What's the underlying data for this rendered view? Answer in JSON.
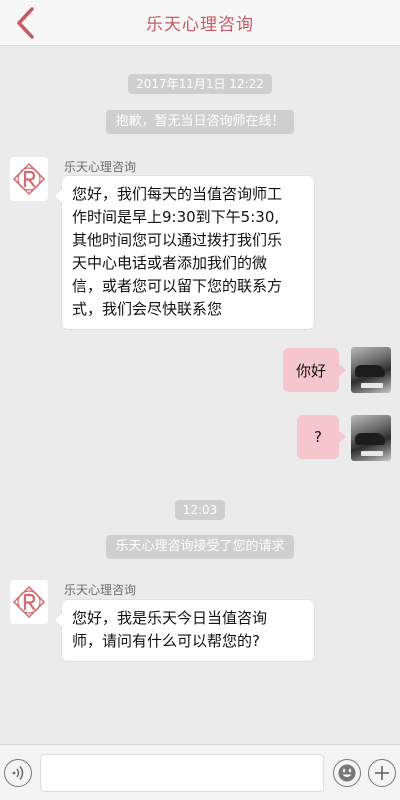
{
  "header": {
    "title": "乐天心理咨询",
    "back_icon": "chevron-left-icon"
  },
  "messages": {
    "timestamp_1": "2017年11月1日 12:22",
    "notice_1": "抱歉，暂无当日咨询师在线！",
    "sender_1": "乐天心理咨询",
    "msg_1_lines": [
      "您好，我们每天的当值咨询师工",
      "作时间是早上9:30到下午5:30,",
      "其他时间您可以通过拨打我们乐",
      "天中心电话或者添加我们的微",
      "信，或者您可以留下您的联系方",
      "式，我们会尽快联系您"
    ],
    "user_msg_1": "你好",
    "user_msg_2": "?",
    "timestamp_2": "12:03",
    "notice_2": "乐天心理咨询接受了您的请求",
    "sender_2": "乐天心理咨询",
    "msg_2_lines": [
      "您好，我是乐天今日当值咨询",
      "师，请问有什么可以帮您的?"
    ]
  },
  "colors": {
    "brand": "#c85a66",
    "user_bubble": "#f5c7cd",
    "system_pill": "#cfcfcf",
    "background": "#ebebeb"
  },
  "input_bar": {
    "text_value": "",
    "voice_icon": "voice-icon",
    "emoji_icon": "emoji-icon",
    "plus_icon": "plus-icon"
  }
}
